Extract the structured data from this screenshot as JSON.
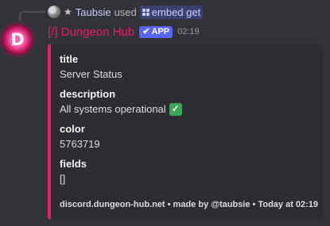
{
  "reply": {
    "user": "Taubsie",
    "used": "used",
    "command": "embed get"
  },
  "message": {
    "bot_name": "[/] Dungeon Hub",
    "badge": "APP",
    "timestamp": "02:19",
    "avatar_letter": "D"
  },
  "embed": {
    "accent_color": "#e91e63",
    "fields": [
      {
        "name": "title",
        "value": "Server Status"
      },
      {
        "name": "description",
        "value": "All systems operational",
        "emoji": "✓"
      },
      {
        "name": "color",
        "value": "5763719"
      },
      {
        "name": "fields",
        "value": "[]"
      }
    ],
    "footer": "discord.dungeon-hub.net • made by @taubsie • Today at 02:19"
  }
}
